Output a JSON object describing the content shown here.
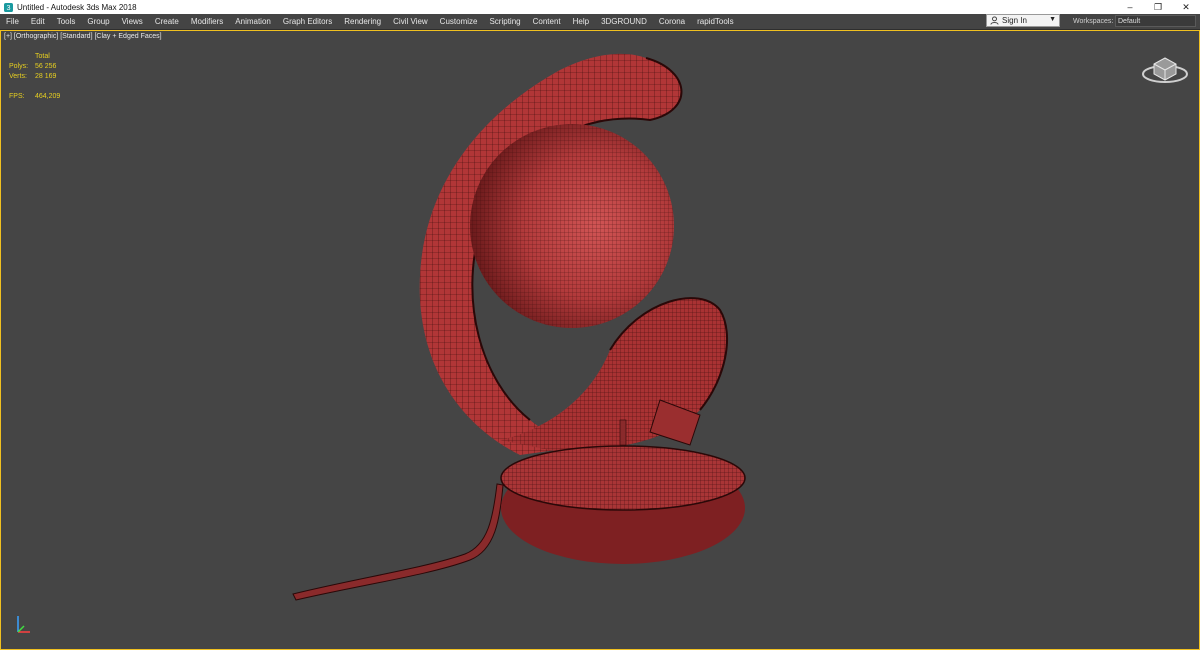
{
  "window": {
    "title": "Untitled - Autodesk 3ds Max 2018",
    "controls": {
      "minimize": "–",
      "restore": "❐",
      "close": "✕"
    }
  },
  "menu": {
    "items": [
      "File",
      "Edit",
      "Tools",
      "Group",
      "Views",
      "Create",
      "Modifiers",
      "Animation",
      "Graph Editors",
      "Rendering",
      "Civil View",
      "Customize",
      "Scripting",
      "Content",
      "Help",
      "3DGROUND",
      "Corona",
      "rapidTools"
    ]
  },
  "account": {
    "sign_in": "Sign In"
  },
  "workspaces": {
    "label": "Workspaces:",
    "value": "Default"
  },
  "viewport": {
    "label": "[+] [Orthographic] [Standard] [Clay + Edged Faces]",
    "stats": {
      "header": "Total",
      "polys_label": "Polys:",
      "polys_value": "56 256",
      "verts_label": "Verts:",
      "verts_value": "28 169",
      "fps_label": "FPS:",
      "fps_value": "464,209"
    }
  },
  "colors": {
    "viewport_bg": "#454545",
    "active_border": "#f0c020",
    "stats_text": "#e8d020",
    "model_clay": "#b5393a"
  },
  "icons": {
    "app": "3dsmax-app-icon",
    "viewcube": "viewcube-icon",
    "axis": "axis-tripod-icon",
    "user": "user-icon"
  }
}
